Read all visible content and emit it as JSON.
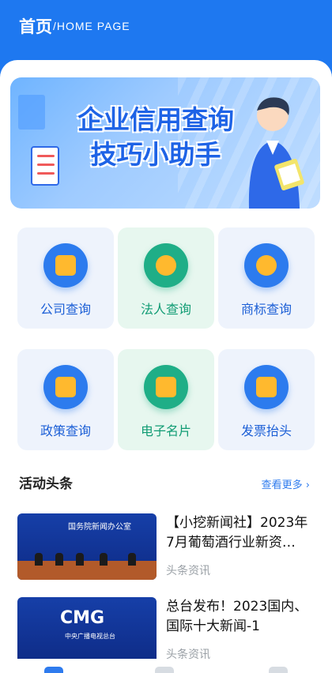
{
  "header": {
    "title": "首页",
    "subtitle": "/HOME PAGE"
  },
  "banner": {
    "line1": "企业信用查询",
    "line2": "技巧小助手"
  },
  "grid_row1": [
    {
      "label": "公司查询",
      "icon": "building-icon",
      "variant": "blue"
    },
    {
      "label": "法人查询",
      "icon": "person-search-icon",
      "variant": "green"
    },
    {
      "label": "商标查询",
      "icon": "trademark-icon",
      "variant": "blue"
    }
  ],
  "grid_row2": [
    {
      "label": "政策查询",
      "icon": "policy-doc-icon",
      "variant": "blue"
    },
    {
      "label": "电子名片",
      "icon": "business-card-icon",
      "variant": "green"
    },
    {
      "label": "发票抬头",
      "icon": "invoice-icon",
      "variant": "blue"
    }
  ],
  "section": {
    "title": "活动头条",
    "more": "查看更多 ›"
  },
  "news": [
    {
      "title": "【小挖新闻社】2023年7月葡萄酒行业新资…",
      "source": "头条资讯",
      "thumb_text": "国务院新闻办公室"
    },
    {
      "title": "总台发布！2023国内、国际十大新闻-1",
      "source": "头条资讯",
      "thumb_text": "CMG",
      "thumb_sub": "中央广播电视总台"
    }
  ],
  "colors": {
    "brand": "#1E78F0",
    "green": "#1FAE87",
    "accent": "#FFB92E"
  }
}
